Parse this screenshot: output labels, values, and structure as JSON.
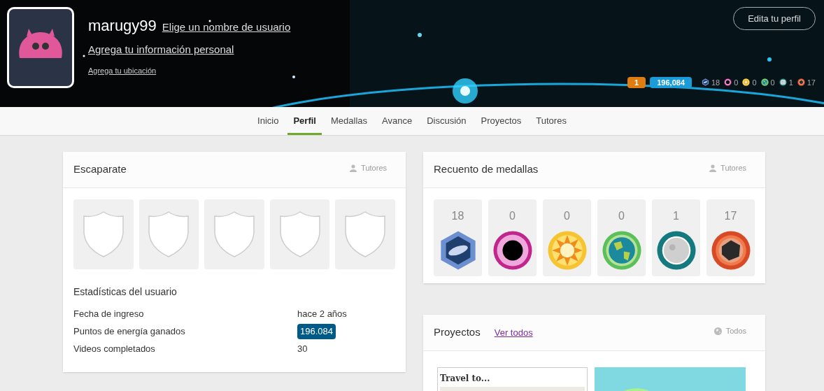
{
  "header": {
    "username": "marugy99",
    "choose_username": "Elige un nombre de usuario",
    "add_info": "Agrega tu información personal",
    "add_location": "Agrega tu ubicación",
    "edit_button": "Edita tu perfil",
    "streak": "1",
    "points": "196,084",
    "badges": [
      {
        "kind": "galaxy",
        "count": "18"
      },
      {
        "kind": "blackhole",
        "count": "0"
      },
      {
        "kind": "sun",
        "count": "0"
      },
      {
        "kind": "earth",
        "count": "0"
      },
      {
        "kind": "moon",
        "count": "1"
      },
      {
        "kind": "meteor",
        "count": "17"
      }
    ]
  },
  "tabs": [
    {
      "label": "Inicio",
      "selected": false
    },
    {
      "label": "Perfil",
      "selected": true
    },
    {
      "label": "Medallas",
      "selected": false
    },
    {
      "label": "Avance",
      "selected": false
    },
    {
      "label": "Discusión",
      "selected": false
    },
    {
      "label": "Proyectos",
      "selected": false
    },
    {
      "label": "Tutores",
      "selected": false
    }
  ],
  "showcase": {
    "title": "Escaparate",
    "visibility": "Tutores",
    "slots": [
      {
        "kind": "empty"
      },
      {
        "kind": "empty"
      },
      {
        "kind": "empty"
      },
      {
        "kind": "empty"
      },
      {
        "kind": "empty"
      }
    ],
    "stats_title": "Estadísticas del usuario",
    "stats": [
      {
        "label": "Fecha de ingreso",
        "value": "hace 2 años",
        "kind": "text"
      },
      {
        "label": "Puntos de energía ganados",
        "value": "196.084",
        "kind": "points"
      },
      {
        "label": "Videos completados",
        "value": "30",
        "kind": "text"
      }
    ]
  },
  "medal_count": {
    "title": "Recuento de medallas",
    "visibility": "Tutores",
    "medals": [
      {
        "kind": "galaxy",
        "count": "18"
      },
      {
        "kind": "blackhole",
        "count": "0"
      },
      {
        "kind": "sun",
        "count": "0"
      },
      {
        "kind": "earth",
        "count": "0"
      },
      {
        "kind": "moon",
        "count": "1"
      },
      {
        "kind": "meteor",
        "count": "17"
      }
    ]
  },
  "projects": {
    "title": "Proyectos",
    "see_all": "Ver todos",
    "visibility": "Todos",
    "items": [
      {
        "kind": "text",
        "title": "Travel to..."
      },
      {
        "kind": "picture"
      }
    ]
  }
}
